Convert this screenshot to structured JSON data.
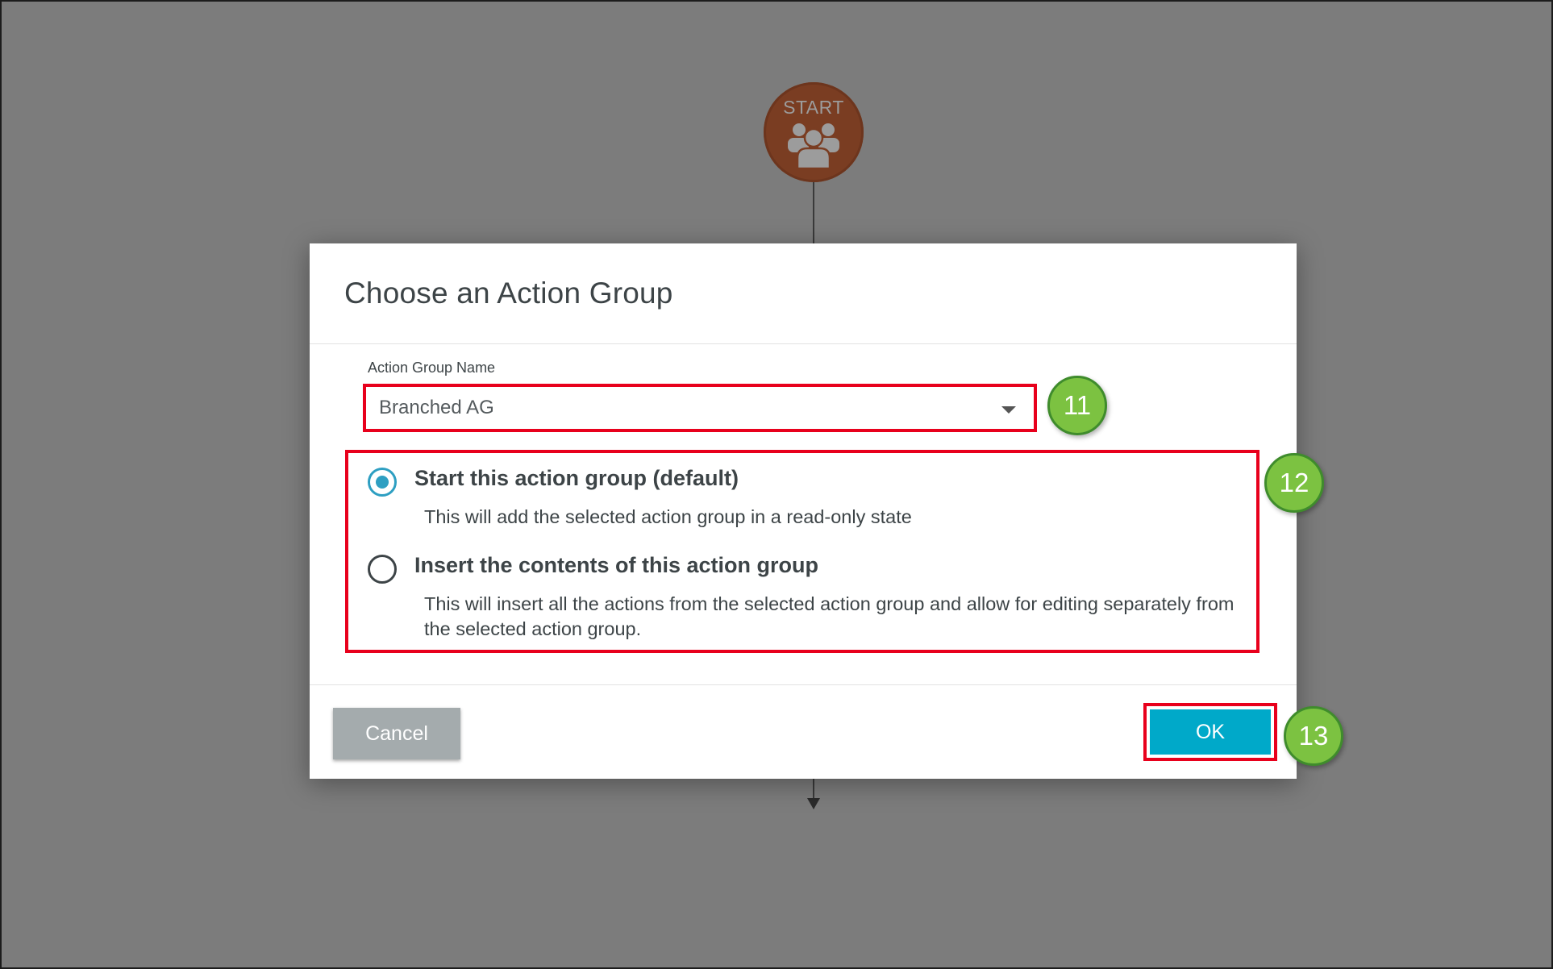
{
  "workflow": {
    "start_label": "START",
    "start_icon": "users-group-icon"
  },
  "dialog": {
    "title": "Choose an Action Group",
    "field_label": "Action Group Name",
    "selected_value": "Branched AG",
    "options": [
      {
        "title": "Start this action group (default)",
        "description": "This will add the selected action group in a read-only state",
        "checked": true
      },
      {
        "title": "Insert the contents of this action group",
        "description": "This will insert all the actions from the selected action group and allow for editing separately from the selected action group.",
        "checked": false
      }
    ],
    "cancel_label": "Cancel",
    "ok_label": "OK"
  },
  "callouts": [
    {
      "label": "11"
    },
    {
      "label": "12"
    },
    {
      "label": "13"
    }
  ],
  "colors": {
    "backdrop": "#7c7c7c",
    "start_node": "#7a3d22",
    "highlight": "#e8001c",
    "radio_accent": "#2e9fc2",
    "ok_button": "#00a9c9",
    "cancel_button": "#a4abad",
    "callout_badge": "#7cc241"
  }
}
